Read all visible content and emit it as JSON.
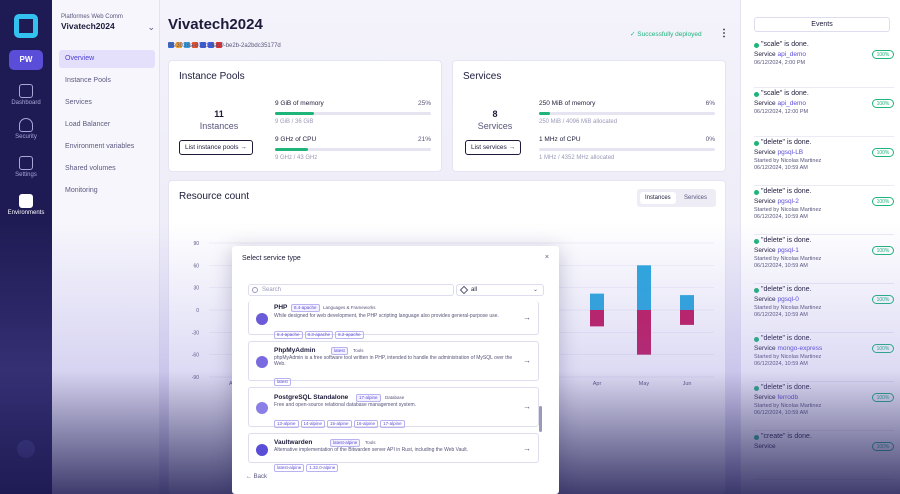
{
  "workspace": {
    "badge": "PW"
  },
  "rail": [
    {
      "label": "Dashboard"
    },
    {
      "label": "Security"
    },
    {
      "label": "Settings"
    },
    {
      "label": "Environments"
    }
  ],
  "org": {
    "company": "Platformes Web Comm",
    "environment": "Vivatech2024"
  },
  "nav": [
    "Overview",
    "Instance Pools",
    "Services",
    "Load Balancer",
    "Environment variables",
    "Shared volumes",
    "Monitoring"
  ],
  "header": {
    "title": "Vivatech2024",
    "id": "9fe3038a-801d-4ab9-be2b-2a2bdc35177d",
    "status": "✓ Successfully deployed",
    "menu": "⋮",
    "icon_colors": [
      "#2f6de1",
      "#f4a02a",
      "#33a0e0",
      "#e4532b",
      "#3b5bdb",
      "#3b5bdb",
      "#e03131"
    ]
  },
  "instance_pools": {
    "title": "Instance Pools",
    "count": "11",
    "count_label": "Instances",
    "button": "List instance pools →",
    "memory": {
      "label": "9 GiB of memory",
      "pct_text": "25%",
      "fraction": 0.25,
      "sub": "9 GiB / 36 GiB"
    },
    "cpu": {
      "label": "9 GHz of CPU",
      "pct_text": "21%",
      "fraction": 0.21,
      "sub": "9 GHz / 43 GHz"
    }
  },
  "services": {
    "title": "Services",
    "count": "8",
    "count_label": "Services",
    "button": "List services →",
    "memory": {
      "label": "250 MiB of memory",
      "pct_text": "6%",
      "fraction": 0.06,
      "sub": "250 MiB / 4096 MiB allocated"
    },
    "cpu": {
      "label": "1 MHz of CPU",
      "pct_text": "0%",
      "fraction": 0.0,
      "sub": "1 MHz / 4352 MHz allocated"
    }
  },
  "resource": {
    "title": "Resource count",
    "toggle_on": "Instances",
    "toggle_off": "Services"
  },
  "chart_data": {
    "type": "bar",
    "title": "Resource count",
    "y_ticks": [
      90,
      60,
      30,
      0,
      -30,
      -60,
      -90
    ],
    "ylim": [
      -90,
      90
    ],
    "categories": [
      "Apr",
      "May",
      "Jun"
    ],
    "series": [
      {
        "color": "#2aa9de",
        "values": [
          22,
          60,
          20
        ]
      },
      {
        "color": "#c2185b",
        "values": [
          -22,
          -60,
          -20
        ]
      }
    ],
    "visible_x_prefix": "A"
  },
  "events": {
    "heading": "Events",
    "items": [
      {
        "title": "\"scale\" is done.",
        "svc_prefix": "Service ",
        "svc": "api_demo",
        "by": "",
        "date": "06/12/2024, 2:00 PM",
        "pct": "100%"
      },
      {
        "title": "\"scale\" is done.",
        "svc_prefix": "Service ",
        "svc": "api_demo",
        "by": "",
        "date": "06/12/2024, 12:00 PM",
        "pct": "100%"
      },
      {
        "title": "\"delete\" is done.",
        "svc_prefix": "Service ",
        "svc": "pgsql-LB",
        "by": "Started by Nicolas Martinez",
        "date": "06/12/2024, 10:59 AM",
        "pct": "100%"
      },
      {
        "title": "\"delete\" is done.",
        "svc_prefix": "Service ",
        "svc": "pgsql-2",
        "by": "Started by Nicolas Martinez",
        "date": "06/12/2024, 10:59 AM",
        "pct": "100%"
      },
      {
        "title": "\"delete\" is done.",
        "svc_prefix": "Service ",
        "svc": "pgsql-1",
        "by": "Started by Nicolas Martinez",
        "date": "06/12/2024, 10:59 AM",
        "pct": "100%"
      },
      {
        "title": "\"delete\" is done.",
        "svc_prefix": "Service ",
        "svc": "pgsql-0",
        "by": "Started by Nicolas Martinez",
        "date": "06/12/2024, 10:59 AM",
        "pct": "100%"
      },
      {
        "title": "\"delete\" is done.",
        "svc_prefix": "Service ",
        "svc": "mongo-express",
        "by": "Started by Nicolas Martinez",
        "date": "06/12/2024, 10:59 AM",
        "pct": "100%"
      },
      {
        "title": "\"delete\" is done.",
        "svc_prefix": "Service ",
        "svc": "ferrodb",
        "by": "Started by Nicolas Martinez",
        "date": "06/12/2024, 10:59 AM",
        "pct": "100%"
      },
      {
        "title": "\"create\" is done.",
        "svc_prefix": "Service ",
        "svc": "",
        "by": "",
        "date": "",
        "pct": "100%"
      }
    ]
  },
  "modal": {
    "title": "Select service type",
    "close": "×",
    "search_placeholder": "Search",
    "filter_value": "all",
    "filter_chevron": "⌄",
    "back": "← Back",
    "arrow": "→",
    "services": [
      {
        "name": "PHP",
        "badge": "8.4-apache",
        "category": "Languages & Frameworks",
        "desc": "While designed for web development, the PHP scripting language also provides general-purpose use.",
        "tags": [
          "8.4-apache",
          "8.3-apache",
          "8.2-apache"
        ],
        "icon_color": "#6b5bd8"
      },
      {
        "name": "PhpMyAdmin",
        "badge": "latest",
        "category": "Tools",
        "desc": "phpMyAdmin is a free software tool written in PHP, intended to handle the administration of MySQL over the Web.",
        "tags": [
          "latest"
        ],
        "icon_color": "#7a6ae0"
      },
      {
        "name": "PostgreSQL Standalone",
        "badge": "17-alpine",
        "category": "Database",
        "desc": "Free and open-source relational database management system.",
        "tags": [
          "13-alpine",
          "14-alpine",
          "15-alpine",
          "16-alpine",
          "17-alpine"
        ],
        "icon_color": "#8a7fe6"
      },
      {
        "name": "Vaultwarden",
        "badge": "latest-alpine",
        "category": "Tools",
        "desc": "Alternative implementation of the Bitwarden server API in Rust, including the Web Vault.",
        "tags": [
          "latest-alpine",
          "1.32.0-alpine"
        ],
        "icon_color": "#5a4ed8"
      }
    ]
  }
}
